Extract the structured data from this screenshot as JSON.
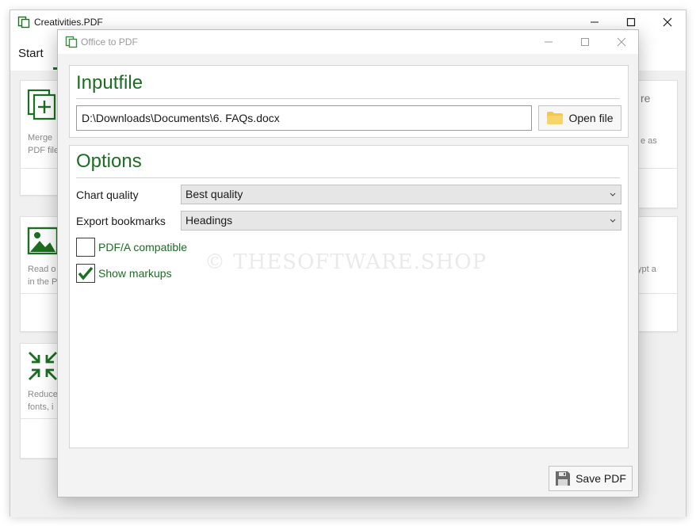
{
  "main_window": {
    "title": "Creativities.PDF",
    "tab_start": "Start",
    "cards": [
      {
        "text_lines": [
          "Merge",
          "PDF file"
        ]
      },
      {
        "text_lines": [
          "Read o",
          "in the P"
        ]
      },
      {
        "text_lines": [
          "Reduce",
          "fonts, i"
        ]
      }
    ],
    "right_cards": [
      {
        "title": "re",
        "text_lines": [
          "e as"
        ]
      },
      {
        "text_lines": [
          "ypt a"
        ]
      }
    ]
  },
  "dialog": {
    "title": "Office to PDF",
    "inputfile": {
      "heading": "Inputfile",
      "path_value": "D:\\Downloads\\Documents\\6. FAQs.docx",
      "open_file_label": "Open file"
    },
    "options": {
      "heading": "Options",
      "chart_quality_label": "Chart quality",
      "chart_quality_value": "Best quality",
      "export_bookmarks_label": "Export bookmarks",
      "export_bookmarks_value": "Headings",
      "pdfa_label": "PDF/A compatible",
      "pdfa_checked": false,
      "markups_label": "Show markups",
      "markups_checked": true
    },
    "save_pdf_label": "Save PDF"
  },
  "watermark": "© THESOFTWARE.SHOP",
  "colors": {
    "accent_green": "#1b6e22",
    "folder_yellow": "#f2c94c",
    "disk_gray": "#6b6b6b"
  },
  "icons": {
    "app": "app-pages-icon",
    "folder": "folder-icon",
    "save": "floppy-disk-icon",
    "check": "checkmark-icon",
    "chevron": "chevron-down-icon"
  }
}
